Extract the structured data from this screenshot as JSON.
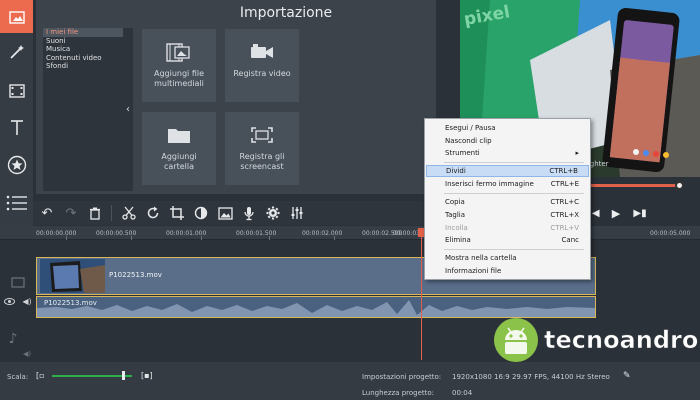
{
  "tools": [
    "import-icon",
    "magic-wand-icon",
    "film-icon",
    "text-icon",
    "star-icon",
    "list-icon"
  ],
  "import_panel": {
    "title": "Importazione",
    "categories": [
      "I miei file",
      "Suoni",
      "Musica",
      "Contenuti video",
      "Sfondi"
    ],
    "tiles": {
      "add_files": "Aggiungi file multimediali",
      "record_video": "Registra video",
      "add_folder": "Aggiungi cartella",
      "record_screencast": "Registra gli screencast"
    }
  },
  "preview": {
    "screen_text": "pixel",
    "phone_badge": "#lighter"
  },
  "ruler": {
    "ticks": [
      "00:00:00.000",
      "00:00:00.500",
      "00:00:01.000",
      "00:00:01.500",
      "00:00:02.000",
      "00:00:02.500",
      "00:00:03",
      "00:00:05.000"
    ]
  },
  "timeline": {
    "video_clip_name": "P1022513.mov",
    "audio_clip_name": "P1022513.mov"
  },
  "context_menu": {
    "items": [
      {
        "label": "Esegui / Pausa",
        "shortcut": ""
      },
      {
        "label": "Nascondi clip",
        "shortcut": ""
      },
      {
        "label": "Strumenti",
        "shortcut": "▸"
      },
      {
        "label": "Dividi",
        "shortcut": "CTRL+B"
      },
      {
        "label": "Inserisci fermo immagine",
        "shortcut": "CTRL+E"
      },
      {
        "label": "Copia",
        "shortcut": "CTRL+C"
      },
      {
        "label": "Taglia",
        "shortcut": "CTRL+X"
      },
      {
        "label": "Incolla",
        "shortcut": "CTRL+V"
      },
      {
        "label": "Elimina",
        "shortcut": "Canc"
      },
      {
        "label": "Mostra nella cartella",
        "shortcut": ""
      },
      {
        "label": "Informazioni file",
        "shortcut": ""
      }
    ]
  },
  "status": {
    "scale_label": "Scala:",
    "settings_label": "Impostazioni progetto:",
    "settings_value": "1920x1080 16:9 29.97 FPS, 44100 Hz Stereo",
    "length_label": "Lunghezza progetto:",
    "length_value": "00:04"
  },
  "watermark": {
    "text": "tecnoandroid"
  },
  "colors": {
    "accent": "#ec6a4e",
    "menu_highlight": "#c8dcf5",
    "zoom_slider": "#2bb04a",
    "watermark_green": "#8bc34a"
  }
}
